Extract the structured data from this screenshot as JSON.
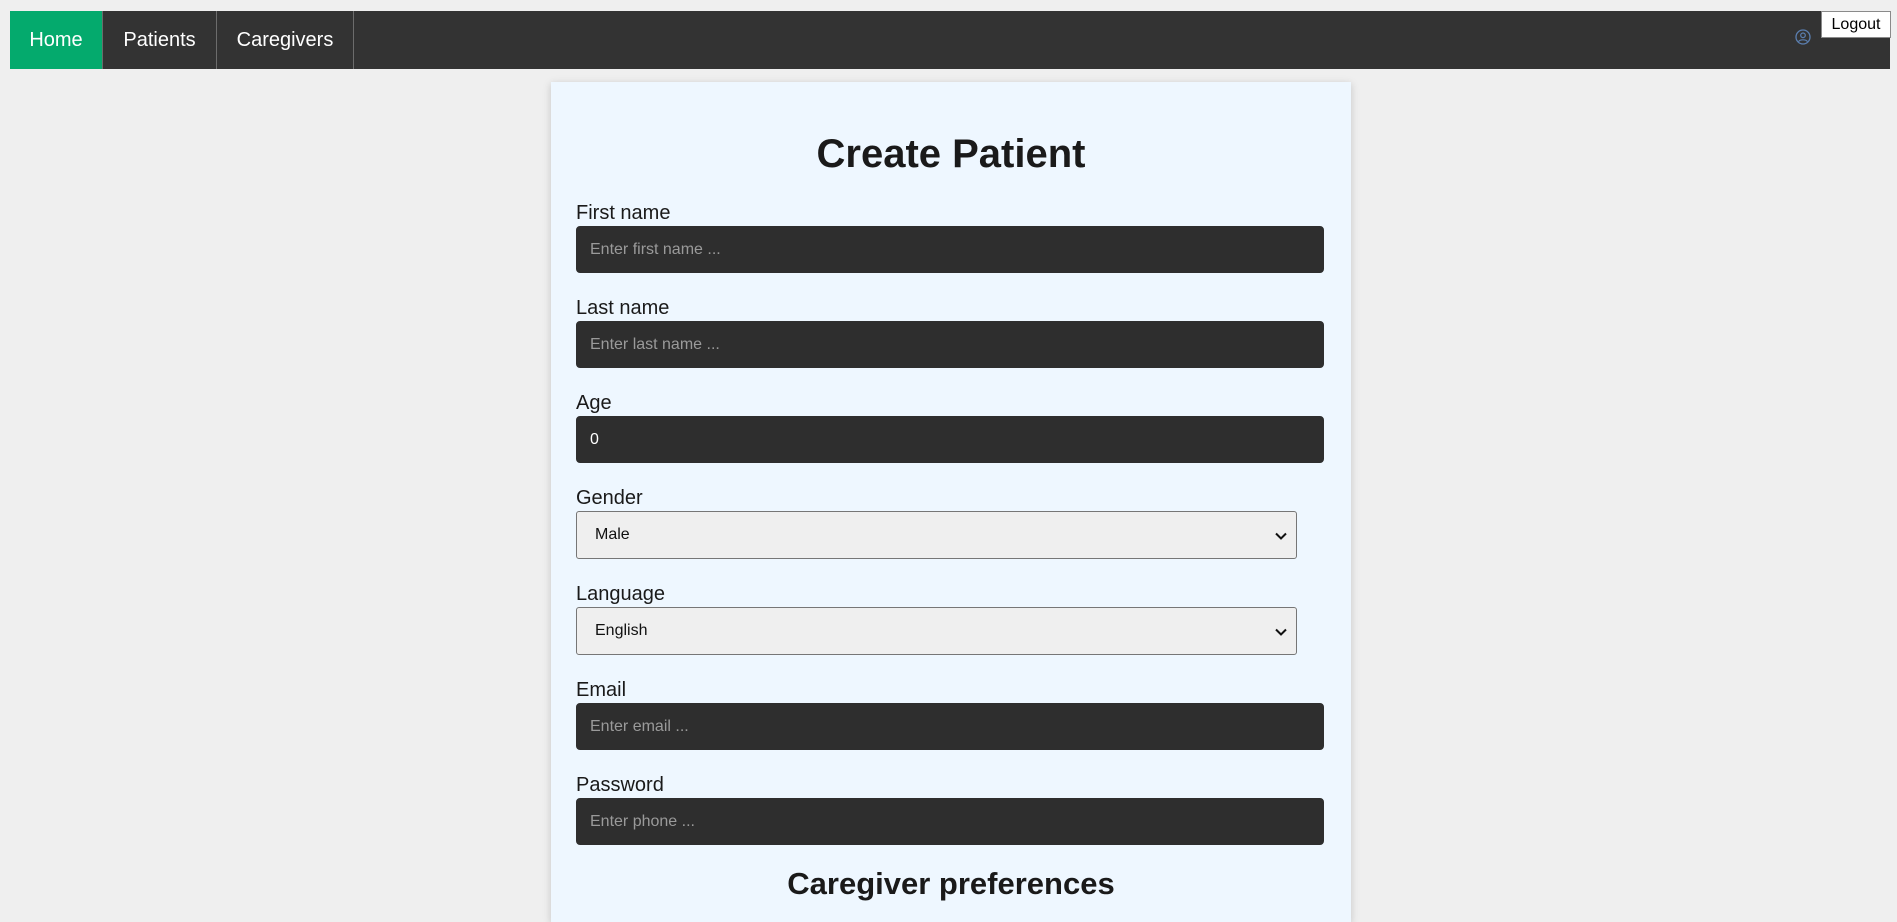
{
  "nav": {
    "items": [
      {
        "label": "Home"
      },
      {
        "label": "Patients"
      },
      {
        "label": "Caregivers"
      }
    ],
    "logout_label": "Logout"
  },
  "colors": {
    "active_nav": "#04aa6d",
    "navbar": "#333333",
    "card": "#eef7ff",
    "input": "#2e2e2e"
  },
  "form": {
    "title": "Create Patient",
    "first_name": {
      "label": "First name",
      "placeholder": "Enter first name ...",
      "value": ""
    },
    "last_name": {
      "label": "Last name",
      "placeholder": "Enter last name ...",
      "value": ""
    },
    "age": {
      "label": "Age",
      "value": "0"
    },
    "gender": {
      "label": "Gender",
      "selected": "Male"
    },
    "language": {
      "label": "Language",
      "selected": "English"
    },
    "email": {
      "label": "Email",
      "placeholder": "Enter email ...",
      "value": ""
    },
    "password": {
      "label": "Password",
      "placeholder": "Enter phone ...",
      "value": ""
    },
    "caregiver_section_title": "Caregiver preferences"
  },
  "icons": {
    "user": "user-circle-icon",
    "select_arrow": "chevron-down-icon"
  }
}
